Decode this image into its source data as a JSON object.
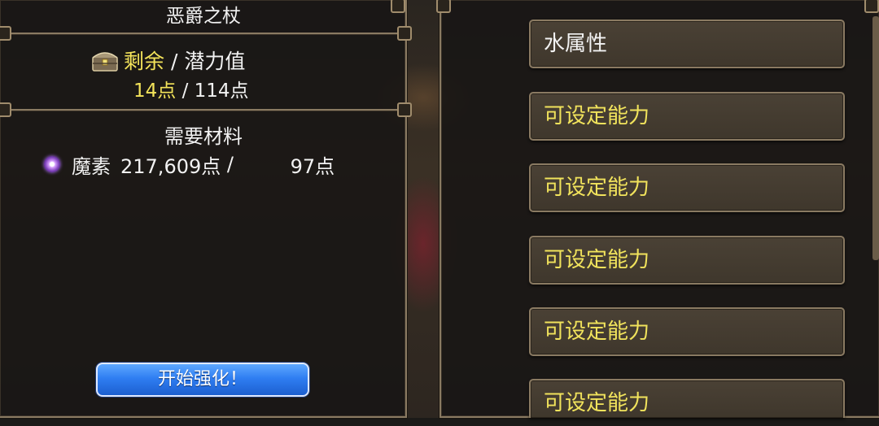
{
  "left_panel": {
    "title": "恶爵之杖",
    "potential": {
      "remaining_label": "剩余",
      "separator": " / ",
      "potential_label": "潜力值",
      "remaining_value": "14点",
      "value_separator": " / ",
      "potential_value": "114点"
    },
    "materials": {
      "title": "需要材料",
      "item_name": "魔素",
      "owned": "217,609点",
      "separator": " / ",
      "required": "97点"
    },
    "start_button_label": "开始强化！"
  },
  "right_panel": {
    "slots": [
      {
        "label": "水属性"
      },
      {
        "label": "可设定能力"
      },
      {
        "label": "可设定能力"
      },
      {
        "label": "可设定能力"
      },
      {
        "label": "可设定能力"
      },
      {
        "label": "可设定能力"
      }
    ]
  },
  "colors": {
    "highlight_yellow": "#f3e35a",
    "button_blue": "#2f7ef2",
    "frame": "#8a7a62"
  },
  "icons": {
    "potential": "treasure-chest-icon",
    "material": "magic-orb-icon"
  }
}
